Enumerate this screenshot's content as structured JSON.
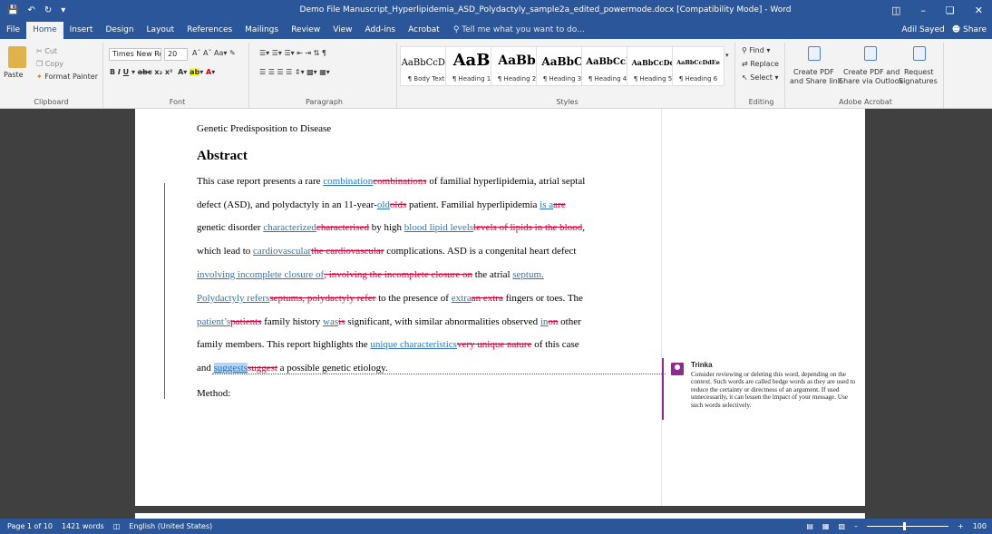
{
  "window": {
    "title": "Demo File Manuscript_Hyperlipidemia_ASD_Polydactyly_sample2a_edited_powermode.docx [Compatibility Mode] - Word",
    "user": "Adil Sayed",
    "share": "Share"
  },
  "tabs": [
    "File",
    "Home",
    "Insert",
    "Design",
    "Layout",
    "References",
    "Mailings",
    "Review",
    "View",
    "Add-ins",
    "Acrobat"
  ],
  "tell_me": "Tell me what you want to do...",
  "ribbon": {
    "clipboard": {
      "paste": "Paste",
      "cut": "Cut",
      "copy": "Copy",
      "format_painter": "Format Painter",
      "label": "Clipboard"
    },
    "font": {
      "name": "Times New Ro",
      "size": "20",
      "label": "Font"
    },
    "paragraph": {
      "label": "Paragraph"
    },
    "styles": {
      "label": "Styles",
      "items": [
        {
          "sample": "AaBbCcDd",
          "name": "¶ Body Text"
        },
        {
          "sample": "AaB",
          "name": "¶ Heading 1"
        },
        {
          "sample": "AaBb",
          "name": "¶ Heading 2"
        },
        {
          "sample": "AaBbC",
          "name": "¶ Heading 3"
        },
        {
          "sample": "AaBbCcl",
          "name": "¶ Heading 4"
        },
        {
          "sample": "AaBbCcDc",
          "name": "¶ Heading 5"
        },
        {
          "sample": "AaBbCcDdEe",
          "name": "¶ Heading 6"
        }
      ]
    },
    "editing": {
      "find": "Find",
      "replace": "Replace",
      "select": "Select",
      "label": "Editing"
    },
    "acrobat": {
      "create_pdf": "Create PDF",
      "create_pdf_sub": "and Share link",
      "create_pdf_and": "Create PDF and",
      "create_pdf_and_sub": "Share via Outlook",
      "request": "Request",
      "request_sub": "Signatures",
      "label": "Adobe Acrobat"
    }
  },
  "document": {
    "section_title": "Genetic Predisposition to Disease",
    "heading": "Abstract",
    "method": "Method:",
    "lines": [
      [
        {
          "t": "n",
          "v": "This case report presents a rare "
        },
        {
          "t": "i",
          "v": "combination"
        },
        {
          "t": "d",
          "v": "combinations"
        },
        {
          "t": "n",
          "v": " of familial hyperlipidemia, atrial septal"
        }
      ],
      [
        {
          "t": "n",
          "v": "defect (ASD), and polydactyly in an 11-year-"
        },
        {
          "t": "i",
          "v": "old"
        },
        {
          "t": "d",
          "v": "olds"
        },
        {
          "t": "n",
          "v": " patient. Familial hyperlipidemia "
        },
        {
          "t": "i",
          "v": "is a"
        },
        {
          "t": "d",
          "v": "are"
        }
      ],
      [
        {
          "t": "n",
          "v": "genetic disorder "
        },
        {
          "t": "i",
          "v": "characterized"
        },
        {
          "t": "d",
          "v": "characterised"
        },
        {
          "t": "n",
          "v": " by high "
        },
        {
          "t": "i",
          "v": "blood lipid levels"
        },
        {
          "t": "d",
          "v": "levels of lipids in the blood"
        },
        {
          "t": "n",
          "v": ","
        }
      ],
      [
        {
          "t": "n",
          "v": "which lead to "
        },
        {
          "t": "i",
          "v": "cardiovascular"
        },
        {
          "t": "d",
          "v": "the cardiovascular"
        },
        {
          "t": "n",
          "v": " complications. ASD is a congenital heart defect"
        }
      ],
      [
        {
          "t": "i",
          "v": "involving incomplete closure of"
        },
        {
          "t": "d",
          "v": ", involving the incomplete closure on"
        },
        {
          "t": "n",
          "v": " the atrial "
        },
        {
          "t": "i",
          "v": "septum."
        }
      ],
      [
        {
          "t": "i",
          "v": "Polydactyly refers"
        },
        {
          "t": "d",
          "v": "septums, polydactyly refer"
        },
        {
          "t": "n",
          "v": " to the presence of "
        },
        {
          "t": "i",
          "v": "extra"
        },
        {
          "t": "d",
          "v": "an extra"
        },
        {
          "t": "n",
          "v": " fingers or toes. The"
        }
      ],
      [
        {
          "t": "i",
          "v": "patient’s"
        },
        {
          "t": "d",
          "v": "patients"
        },
        {
          "t": "n",
          "v": " family history "
        },
        {
          "t": "i",
          "v": "was"
        },
        {
          "t": "d",
          "v": "is"
        },
        {
          "t": "n",
          "v": " significant, with similar abnormalities observed "
        },
        {
          "t": "i",
          "v": "in"
        },
        {
          "t": "d",
          "v": "on"
        },
        {
          "t": "n",
          "v": " other"
        }
      ],
      [
        {
          "t": "n",
          "v": "family members. This report highlights the "
        },
        {
          "t": "i",
          "v": "unique characteristics"
        },
        {
          "t": "d",
          "v": "very unique nature"
        },
        {
          "t": "n",
          "v": " of this case"
        }
      ],
      [
        {
          "t": "n",
          "v": "and "
        },
        {
          "t": "h",
          "v": "suggests"
        },
        {
          "t": "d",
          "v": "suggest"
        },
        {
          "t": "n",
          "v": " a possible genetic etiology."
        }
      ]
    ]
  },
  "comment": {
    "author": "Trinka",
    "text": "Consider reviewing or deleting this word, depending on the context. Such words are called hedge words as they are used to reduce the certainty or directness of an argument. If used unnecessarily, it can lessen the impact of your message. Use such words selectively."
  },
  "status": {
    "page": "Page 1 of 10",
    "words": "1421 words",
    "language": "English (United States)",
    "zoom": "100"
  },
  "colors": {
    "brand": "#2b579a",
    "insert": "#2e75b6",
    "delete": "#e2003a",
    "comment": "#8c2c8c"
  }
}
